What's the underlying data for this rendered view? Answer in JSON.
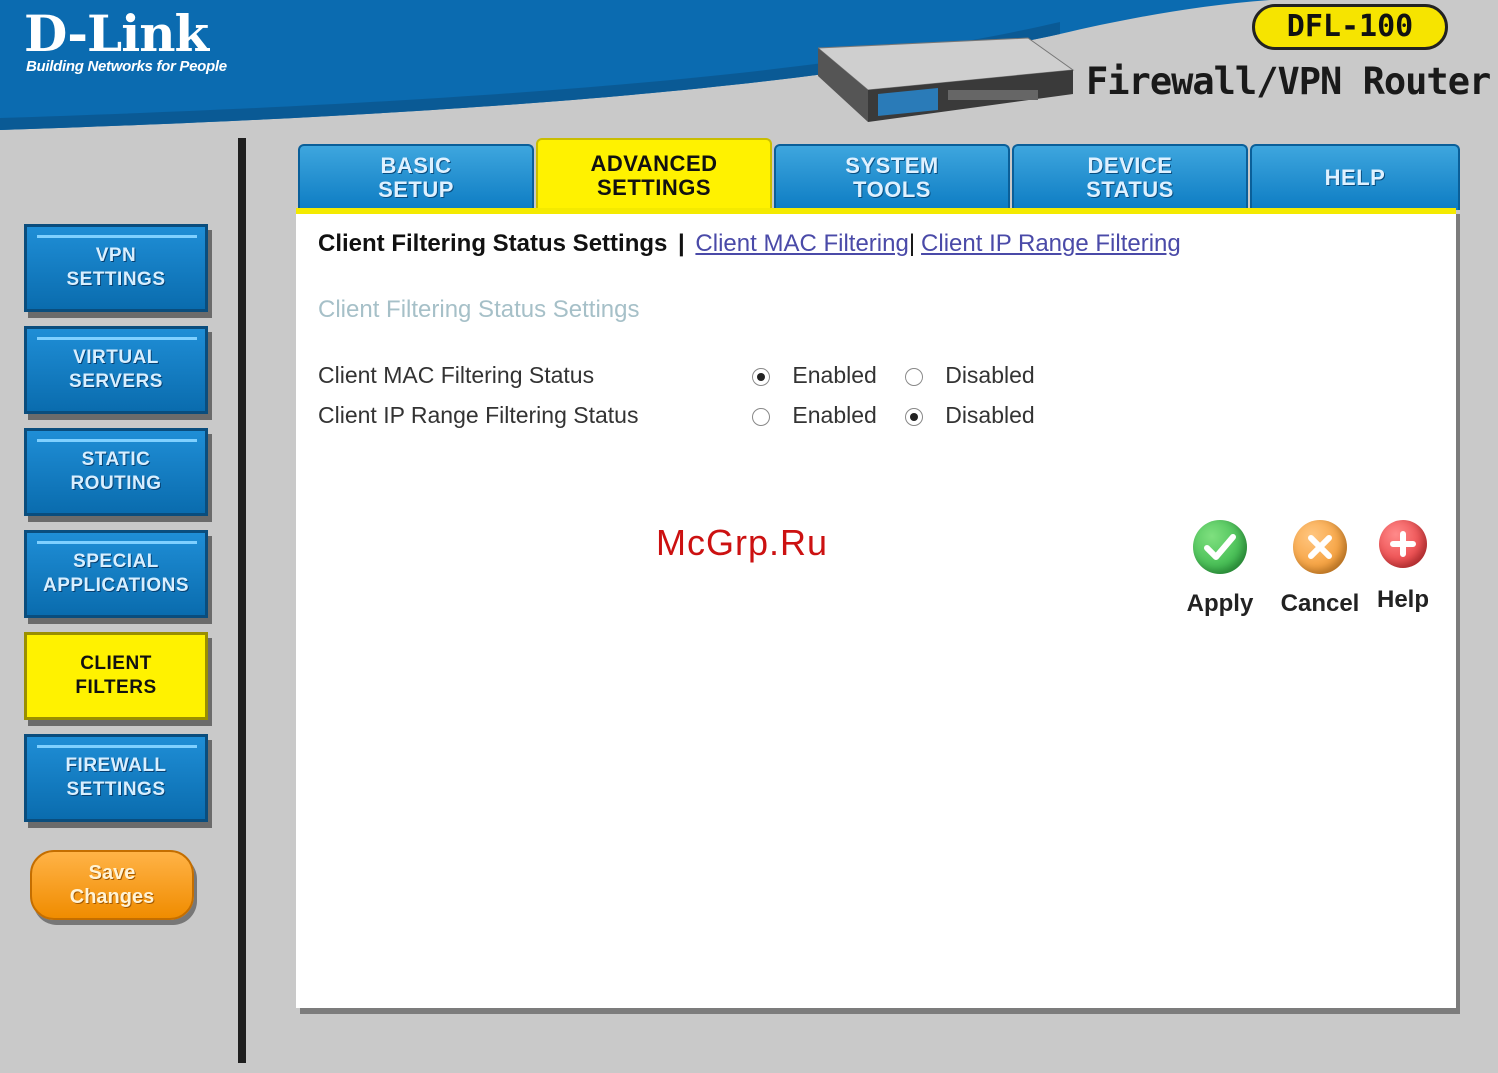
{
  "header": {
    "brand": "D-Link",
    "tagline": "Building Networks for People",
    "model": "DFL-100",
    "product": "Firewall/VPN Router"
  },
  "tabs": [
    {
      "label": "BASIC\nSETUP",
      "active": false
    },
    {
      "label": "ADVANCED\nSETTINGS",
      "active": true
    },
    {
      "label": "SYSTEM\nTOOLS",
      "active": false
    },
    {
      "label": "DEVICE\nSTATUS",
      "active": false
    },
    {
      "label": "HELP",
      "active": false
    }
  ],
  "sidebar": {
    "items": [
      {
        "label": "VPN\nSETTINGS"
      },
      {
        "label": "VIRTUAL\nSERVERS"
      },
      {
        "label": "STATIC\nROUTING"
      },
      {
        "label": "SPECIAL\nAPPLICATIONS"
      },
      {
        "label": "CLIENT\nFILTERS",
        "active": true
      },
      {
        "label": "FIREWALL\nSETTINGS"
      }
    ],
    "save_label": "Save\nChanges"
  },
  "main": {
    "breadcrumb": {
      "current": "Client Filtering Status Settings",
      "separator": "|",
      "link1": "Client MAC Filtering",
      "link2": "Client IP Range Filtering"
    },
    "section_title": "Client Filtering Status Settings",
    "rows": [
      {
        "label": "Client MAC Filtering Status",
        "enabled_label": "Enabled",
        "disabled_label": "Disabled",
        "value": "Enabled"
      },
      {
        "label": "Client IP Range Filtering Status",
        "enabled_label": "Enabled",
        "disabled_label": "Disabled",
        "value": "Disabled"
      }
    ],
    "actions": {
      "apply": "Apply",
      "cancel": "Cancel",
      "help": "Help"
    },
    "watermark": "McGrp.Ru"
  },
  "colors": {
    "accent_yellow": "#fff200",
    "tab_blue": "#0d7cc3",
    "apply_green": "#22a83a",
    "cancel_orange": "#f08c1a",
    "help_red": "#e0262a"
  }
}
